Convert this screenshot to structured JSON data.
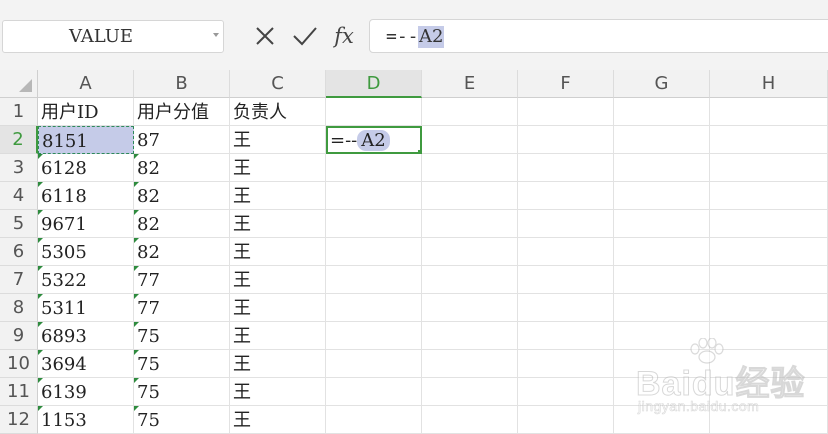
{
  "formula_bar": {
    "name_box": "VALUE",
    "cancel_icon": "close-icon",
    "confirm_icon": "check-icon",
    "fx_label": "fx",
    "formula_prefix": "=--",
    "formula_ref": "A2"
  },
  "sheet": {
    "columns": [
      "A",
      "B",
      "C",
      "D",
      "E",
      "F",
      "G",
      "H"
    ],
    "active_column": "D",
    "rows": [
      "1",
      "2",
      "3",
      "4",
      "5",
      "6",
      "7",
      "8",
      "9",
      "10",
      "11",
      "12"
    ],
    "active_row": "2",
    "header_row": [
      "用户ID",
      "用户分值",
      "负责人"
    ],
    "data": [
      [
        "8151",
        "87",
        "王"
      ],
      [
        "6128",
        "82",
        "王"
      ],
      [
        "6118",
        "82",
        "王"
      ],
      [
        "9671",
        "82",
        "王"
      ],
      [
        "5305",
        "82",
        "王"
      ],
      [
        "5322",
        "77",
        "王"
      ],
      [
        "5311",
        "77",
        "王"
      ],
      [
        "6893",
        "75",
        "王"
      ],
      [
        "3694",
        "75",
        "王"
      ],
      [
        "6139",
        "75",
        "王"
      ],
      [
        "1153",
        "75",
        "王"
      ]
    ],
    "editing_cell": {
      "address": "D2",
      "prefix": "=--",
      "ref": "A2"
    }
  },
  "watermark": {
    "logo_text": "Baidu经验",
    "url": "jingyan.baidu.com"
  },
  "colors": {
    "accent_green": "#3f9a3f",
    "reference_highlight": "#c5cbe8",
    "header_bg": "#f2f2f2"
  }
}
